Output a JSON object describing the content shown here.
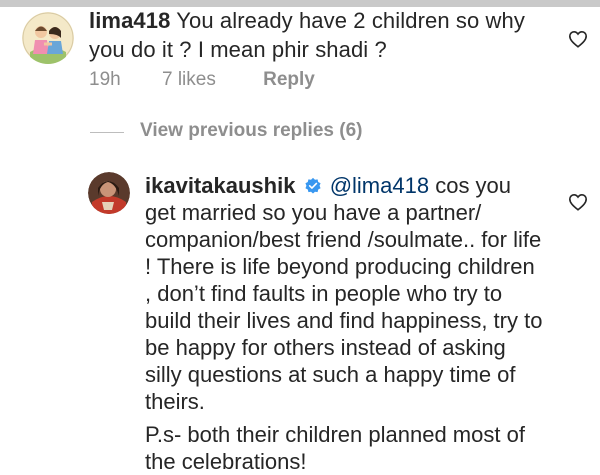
{
  "comment": {
    "username": "lima418",
    "text": "You already have 2 children so why you do it ? I mean phir shadi ?",
    "time": "19h",
    "likes": "7 likes",
    "reply_label": "Reply"
  },
  "view_previous": "View previous replies (6)",
  "reply": {
    "username": "ikavitakaushik",
    "mention": "@lima418",
    "text": "cos you get married so you have a partner/ companion/best friend /soulmate.. for life ! There is life beyond producing children , don’t find faults in people who try to build their lives and find happiness, try to be happy for others instead of asking silly questions at such a happy time of theirs.",
    "ps": "P.s- both their children planned most of the celebrations!"
  },
  "icons": {
    "heart": "heart-icon",
    "verified": "verified-badge-icon",
    "accent": "#3897f0"
  }
}
